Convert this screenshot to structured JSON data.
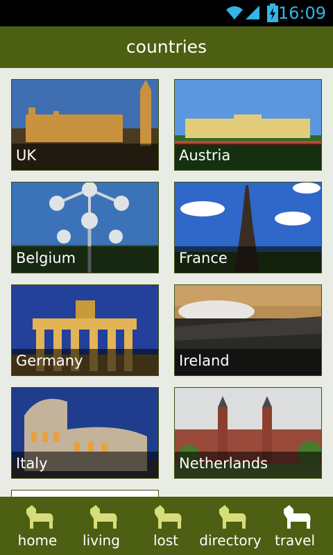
{
  "status_bar": {
    "time": "16:09",
    "icons": [
      "wifi-icon",
      "signal-icon",
      "battery-charging-icon"
    ],
    "time_color": "#35b5e5"
  },
  "title_bar": {
    "title": "countries",
    "background": "#4d5f12"
  },
  "countries": [
    {
      "label": "UK"
    },
    {
      "label": "Austria"
    },
    {
      "label": "Belgium"
    },
    {
      "label": "France"
    },
    {
      "label": "Germany"
    },
    {
      "label": "Ireland"
    },
    {
      "label": "Italy"
    },
    {
      "label": "Netherlands"
    }
  ],
  "bottom_nav": {
    "items": [
      {
        "label": "home",
        "icon": "dog-icon",
        "color": "#d6dd7a"
      },
      {
        "label": "living",
        "icon": "dog-icon",
        "color": "#d6dd7a"
      },
      {
        "label": "lost",
        "icon": "dog-icon",
        "color": "#d6dd7a"
      },
      {
        "label": "directory",
        "icon": "dog-icon",
        "color": "#d6dd7a"
      },
      {
        "label": "travel",
        "icon": "dog-icon",
        "color": "#ffffff",
        "selected": true
      }
    ]
  }
}
